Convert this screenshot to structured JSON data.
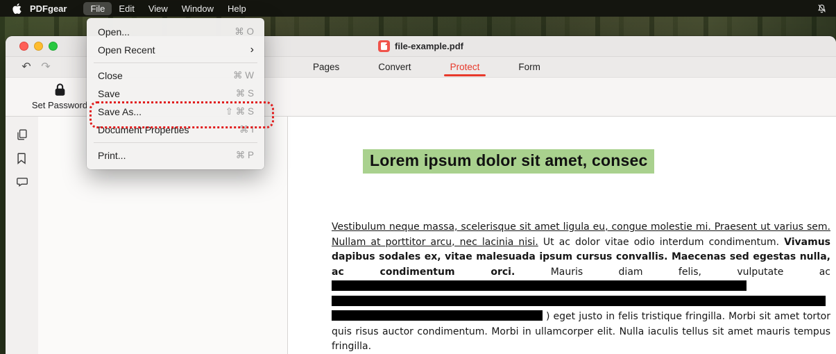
{
  "menubar": {
    "app_name": "PDFgear",
    "menus": [
      {
        "label": "File",
        "open": true
      },
      {
        "label": "Edit"
      },
      {
        "label": "View"
      },
      {
        "label": "Window"
      },
      {
        "label": "Help"
      }
    ]
  },
  "file_menu": {
    "items": [
      {
        "label": "Open...",
        "shortcut": "⌘ O"
      },
      {
        "label": "Open Recent"
      },
      {
        "label": "Close",
        "shortcut": "⌘ W"
      },
      {
        "label": "Save",
        "shortcut": "⌘ S"
      },
      {
        "label": "Save As...",
        "shortcut": "⇧ ⌘ S",
        "annotated": true
      },
      {
        "label": "Document Properties",
        "shortcut": "⌘ I"
      },
      {
        "label": "Print...",
        "shortcut": "⌘ P"
      }
    ]
  },
  "window": {
    "title": "file-example.pdf",
    "tabs": [
      {
        "label": "Pages"
      },
      {
        "label": "Convert"
      },
      {
        "label": "Protect",
        "active": true
      },
      {
        "label": "Form"
      }
    ],
    "active_tab": "Protect",
    "protect_toolbar": {
      "set_password_label": "Set Password"
    }
  },
  "document": {
    "heading": "Lorem ipsum dolor sit amet, consec",
    "paragraph": {
      "underlined": "Vestibulum neque massa, scelerisque sit amet ligula eu, congue molestie mi. Praesent ut varius sem. Nullam at porttitor arcu, nec lacinia nisi.",
      "normal_1": "Ut ac dolor vitae odio interdum condimentum.",
      "bold": "Vivamus dapibus sodales ex, vitae malesuada ipsum cursus convallis. Maecenas sed egestas nulla, ac condimentum orci.",
      "normal_2": "Mauris diam felis, vulputate ac",
      "after_redaction": ") eget justo in felis tristique fringilla. Morbi sit amet tortor quis risus auctor condimentum. Morbi in ullamcorper elit. Nulla iaculis tellus sit amet mauris tempus fringilla."
    }
  },
  "icons": {
    "undo": "↶",
    "redo": "↷",
    "submenu_chevron": "›"
  },
  "colors": {
    "tab_active_red": "#e8392b",
    "heading_highlight_green": "#a9d18e",
    "annotation_red": "#e11d1d",
    "traffic_close": "#ff5f57",
    "traffic_minimize": "#febc2e",
    "traffic_zoom": "#28c840"
  }
}
